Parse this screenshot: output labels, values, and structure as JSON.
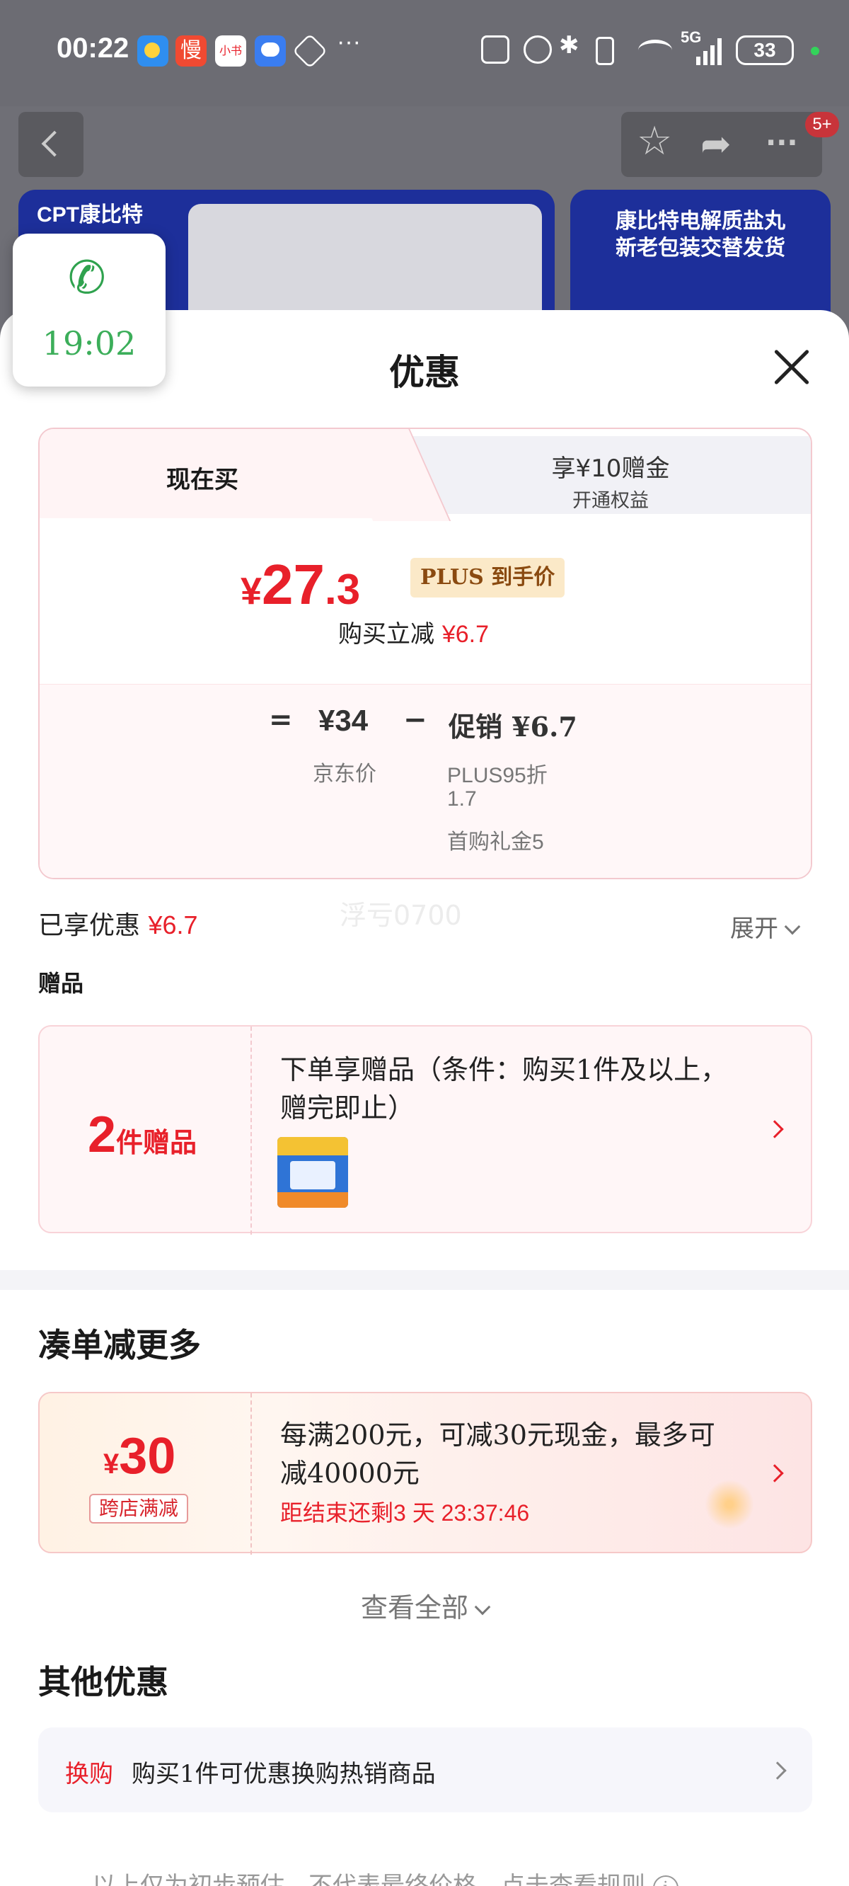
{
  "status_bar": {
    "time": "00:22",
    "app_icons": [
      "weather-icon",
      "slow-app-icon",
      "xiaohongshu-icon",
      "message-icon",
      "hand-icon"
    ],
    "more": "···",
    "network": "5G",
    "battery": "33",
    "colors": {
      "dot": "#33d35a"
    }
  },
  "header": {
    "badge": "5+",
    "banner_left": "CPT康比特",
    "banner_right": [
      "康比特电解质盐丸",
      "新老包装交替发货"
    ]
  },
  "call": {
    "duration": "19:02"
  },
  "sheet": {
    "title": "优惠",
    "tabs": {
      "now": "现在买",
      "other_line1": "享¥10赠金",
      "other_line2": "开通权益"
    },
    "price": {
      "yen": "¥",
      "int": "27",
      "dec": ".3",
      "plus_tag": "PLUS 到手价"
    },
    "instant": {
      "label": "购买立减",
      "amount": "¥6.7"
    },
    "formula": {
      "eq": "=",
      "jd_value": "¥34",
      "jd_label": "京东价",
      "minus": "−",
      "promo_value": "促销 ¥6.7",
      "promo_lines": [
        "PLUS95折",
        "1.7",
        "首购礼金5"
      ]
    },
    "enjoyed": {
      "label": "已享优惠",
      "amount": "¥6.7",
      "watermark": "浮亏0700",
      "expand": "展开"
    },
    "gifts": {
      "section": "赠品",
      "count": "2",
      "count_suffix": "件赠品",
      "desc": "下单享赠品（条件：购买1件及以上，赠完即止）"
    },
    "combo": {
      "title": "凑单减更多",
      "yen": "¥",
      "amount": "30",
      "tag": "跨店满减",
      "desc": "每满200元，可减30元现金，最多可减40000元",
      "countdown_label": "距结束还剩",
      "countdown": "3 天 23:37:46",
      "see_all": "查看全部"
    },
    "other": {
      "title": "其他优惠",
      "swap_tag": "换购",
      "swap_text": "购买1件可优惠换购热销商品"
    },
    "footer": "以上仅为初步预估，不代表最终价格，点击查看规则"
  },
  "colors": {
    "accent": "#e8202a",
    "plus_bg": "#fbe9c8",
    "call_green": "#3cae5a"
  }
}
